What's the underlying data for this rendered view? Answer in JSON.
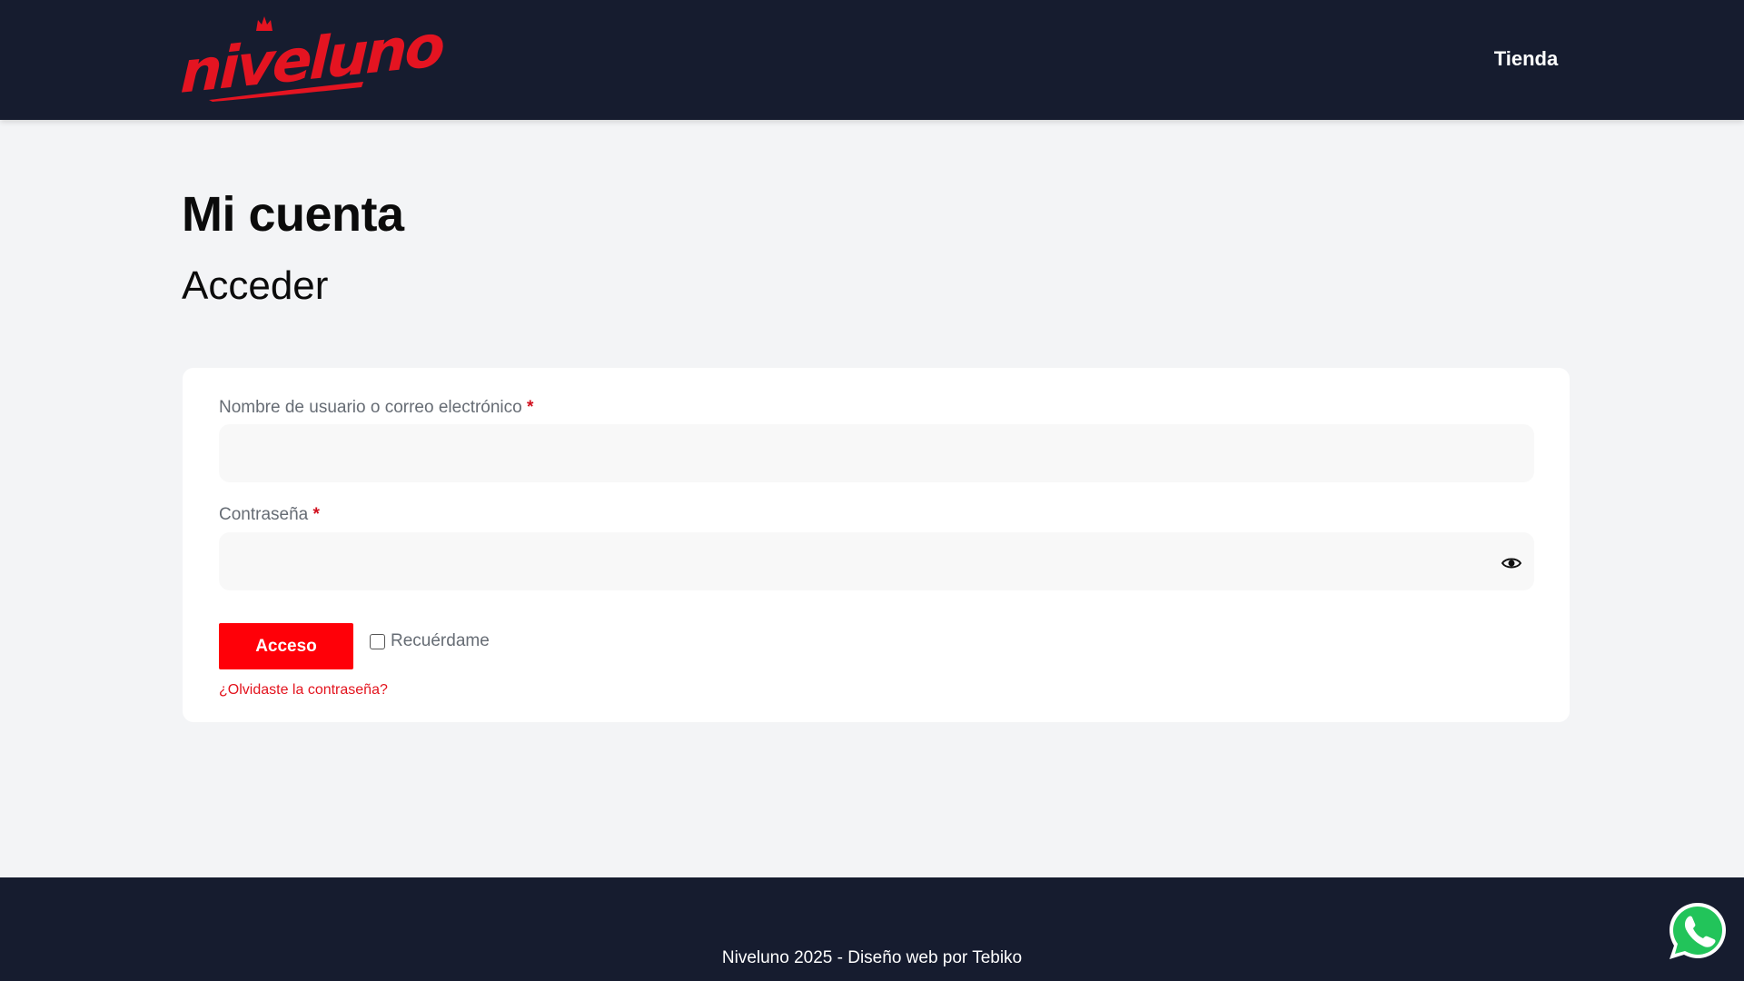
{
  "header": {
    "logo_text": "niveluno",
    "nav_link": "Tienda"
  },
  "main": {
    "page_title": "Mi cuenta",
    "section_title": "Acceder",
    "form": {
      "username_label": "Nombre de usuario o correo electrónico",
      "password_label": "Contraseña",
      "required_marker": "*",
      "username_value": "",
      "password_value": "",
      "submit_label": "Acceso",
      "remember_label": "Recuérdame",
      "remember_checked": false,
      "forgot_link": "¿Olvidaste la contraseña?"
    }
  },
  "footer": {
    "text": "Niveluno 2025 - Diseño web por Tebiko"
  },
  "icons": {
    "password_toggle": "eye-icon",
    "whatsapp": "whatsapp-icon"
  },
  "colors": {
    "header_bg": "#161c2f",
    "accent": "#ff0008",
    "page_bg": "#f3f4f6"
  }
}
